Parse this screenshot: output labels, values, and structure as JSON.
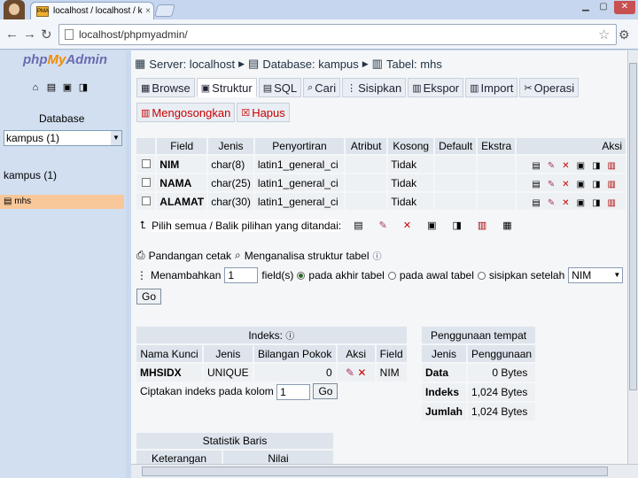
{
  "browser": {
    "tab_title": "localhost / localhost / kampus",
    "tab_favicon_text": "PMA",
    "tab_close": "×",
    "url": "localhost/phpmyadmin/"
  },
  "sidebar": {
    "logo_php": "php",
    "logo_my": "My",
    "logo_admin": "Admin",
    "database_label": "Database",
    "database_select": "kampus (1)",
    "database_name": "kampus (1)",
    "tables": [
      {
        "label": "mhs"
      }
    ]
  },
  "breadcrumb": {
    "server": "Server: localhost",
    "database": "Database: kampus",
    "table": "Tabel: mhs"
  },
  "tabs": [
    {
      "label": "Browse"
    },
    {
      "label": "Struktur"
    },
    {
      "label": "SQL"
    },
    {
      "label": "Cari"
    },
    {
      "label": "Sisipkan"
    },
    {
      "label": "Ekspor"
    },
    {
      "label": "Import"
    },
    {
      "label": "Operasi"
    },
    {
      "label": "Mengosongkan"
    },
    {
      "label": "Hapus"
    }
  ],
  "structure": {
    "headers": [
      "Field",
      "Jenis",
      "Penyortiran",
      "Atribut",
      "Kosong",
      "Default",
      "Ekstra",
      "Aksi"
    ],
    "rows": [
      {
        "field": "NIM",
        "type": "char(8)",
        "collation": "latin1_general_ci",
        "attr": "",
        "null": "Tidak",
        "default": "",
        "extra": ""
      },
      {
        "field": "NAMA",
        "type": "char(25)",
        "collation": "latin1_general_ci",
        "attr": "",
        "null": "Tidak",
        "default": "",
        "extra": ""
      },
      {
        "field": "ALAMAT",
        "type": "char(30)",
        "collation": "latin1_general_ci",
        "attr": "",
        "null": "Tidak",
        "default": "",
        "extra": ""
      }
    ],
    "select_all": "Pilih semua / Balik pilihan yang ditandai:"
  },
  "options": {
    "print_view": "Pandangan cetak",
    "analyze": "Menganalisa struktur tabel",
    "add_label": "Menambahkan",
    "add_count": "1",
    "fields_label": "field(s)",
    "at_end": "pada akhir tabel",
    "at_start": "pada awal tabel",
    "after": "sisipkan setelah",
    "after_field": "NIM",
    "go": "Go"
  },
  "indexes": {
    "title": "Indeks:",
    "headers": [
      "Nama Kunci",
      "Jenis",
      "Bilangan Pokok",
      "Aksi",
      "Field"
    ],
    "rows": [
      {
        "key": "MHSIDX",
        "type": "UNIQUE",
        "cardinality": "0",
        "field": "NIM"
      }
    ],
    "create_label": "Ciptakan indeks pada kolom",
    "create_count": "1",
    "go": "Go"
  },
  "space_usage": {
    "title": "Penggunaan tempat",
    "headers": [
      "Jenis",
      "Penggunaan"
    ],
    "rows": [
      {
        "type": "Data",
        "size": "0",
        "unit": "Bytes"
      },
      {
        "type": "Indeks",
        "size": "1,024",
        "unit": "Bytes"
      },
      {
        "type": "Jumlah",
        "size": "1,024",
        "unit": "Bytes"
      }
    ]
  },
  "row_stats": {
    "title": "Statistik Baris",
    "headers": [
      "Keterangan",
      "Nilai"
    ]
  }
}
